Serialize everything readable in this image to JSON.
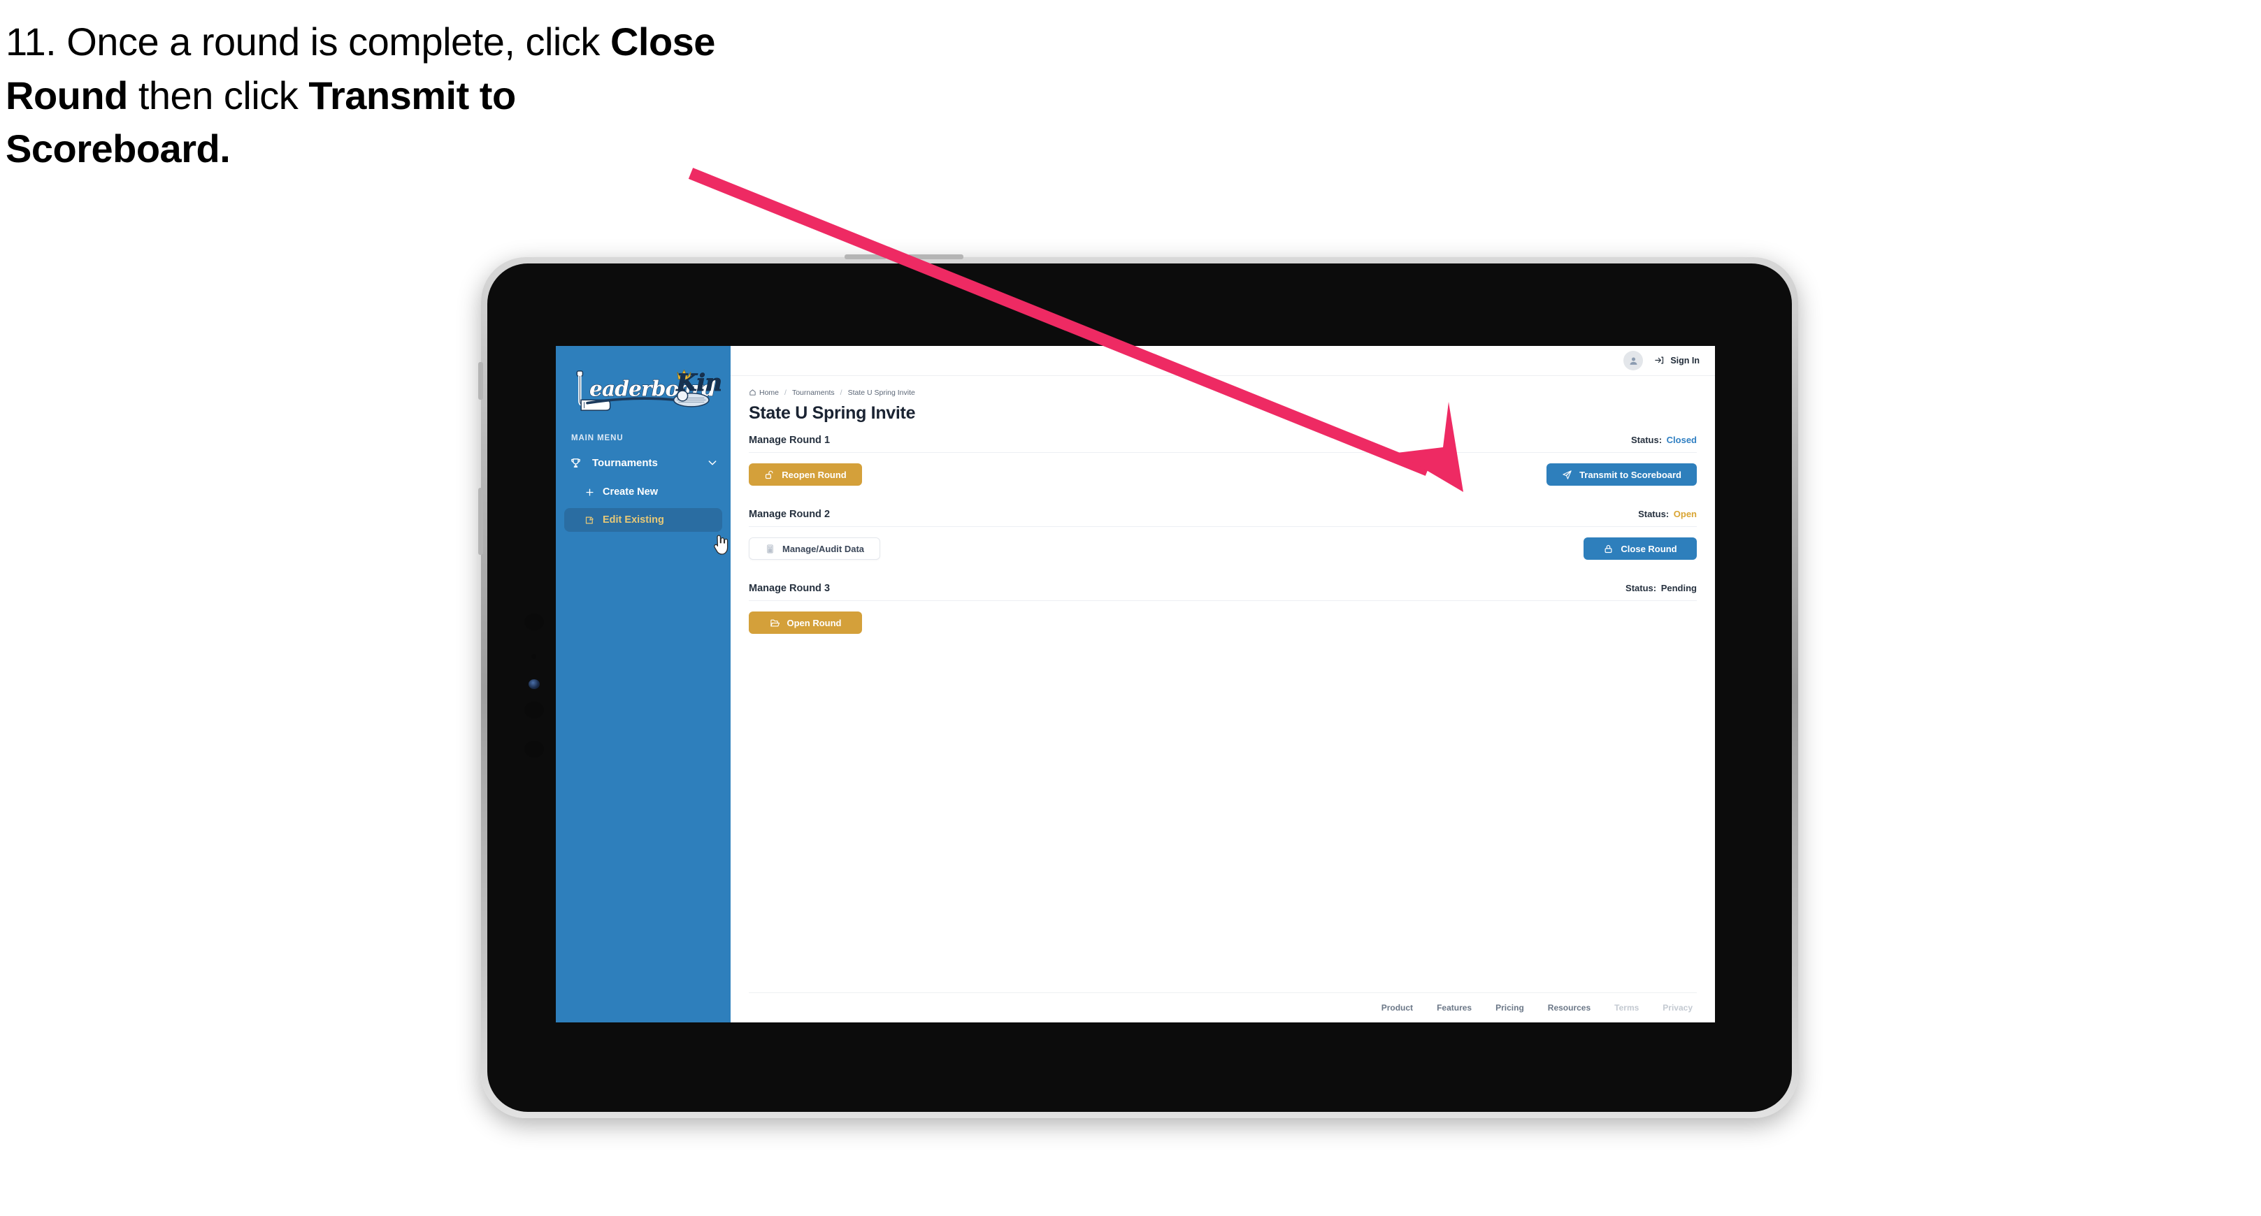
{
  "caption": {
    "part1": "11. Once a round is complete, click ",
    "bold1": "Close Round",
    "part2": " then click ",
    "bold2": "Transmit to Scoreboard."
  },
  "annotation": {
    "arrow_color": "#ee2a63",
    "points_to": "Transmit to Scoreboard"
  },
  "sidebar": {
    "logo": {
      "word1": "Leaderboard",
      "word2": "King",
      "icons": [
        "golf-putter-icon",
        "crown-icon",
        "golf-ball-icon"
      ]
    },
    "menu_label": "MAIN MENU",
    "nav": {
      "label": "Tournaments",
      "icon": "trophy-icon",
      "chevron": "chevron-down-icon"
    },
    "sub_items": [
      {
        "label": "Create New",
        "icon": "plus-icon",
        "active": false
      },
      {
        "label": "Edit Existing",
        "icon": "edit-square-icon",
        "active": true
      }
    ],
    "cursor": "pointing-hand-cursor",
    "colors": {
      "background": "#2E7FBC",
      "active_item_bg": "#2A6DA2",
      "active_item_text": "#E8C977"
    }
  },
  "topbar": {
    "avatar_icon": "user-avatar-icon",
    "signin_icon": "login-arrow-icon",
    "signin_label": "Sign In"
  },
  "breadcrumb": {
    "home_icon": "home-icon",
    "items": [
      "Home",
      "Tournaments",
      "State U Spring Invite"
    ],
    "separator": "/"
  },
  "page": {
    "title": "State U Spring Invite"
  },
  "rounds": [
    {
      "title": "Manage Round 1",
      "status_label": "Status:",
      "status_value": "Closed",
      "status_kind": "closed",
      "left_button": {
        "label": "Reopen Round",
        "icon": "unlock-icon",
        "style": "gold"
      },
      "right_button": {
        "label": "Transmit to Scoreboard",
        "icon": "paper-plane-icon",
        "style": "blue"
      }
    },
    {
      "title": "Manage Round 2",
      "status_label": "Status:",
      "status_value": "Open",
      "status_kind": "open",
      "left_button": {
        "label": "Manage/Audit Data",
        "icon": "calculator-icon",
        "style": "ghost"
      },
      "right_button": {
        "label": "Close Round",
        "icon": "lock-icon",
        "style": "blue"
      }
    },
    {
      "title": "Manage Round 3",
      "status_label": "Status:",
      "status_value": "Pending",
      "status_kind": "pending",
      "left_button": {
        "label": "Open Round",
        "icon": "open-folder-icon",
        "style": "gold"
      },
      "right_button": null
    }
  ],
  "footer": {
    "links": [
      {
        "label": "Product",
        "dim": false
      },
      {
        "label": "Features",
        "dim": false
      },
      {
        "label": "Pricing",
        "dim": false
      },
      {
        "label": "Resources",
        "dim": false
      },
      {
        "label": "Terms",
        "dim": true
      },
      {
        "label": "Privacy",
        "dim": true
      }
    ]
  },
  "colors": {
    "brand_blue": "#2E7FBC",
    "gold": "#D4A03A",
    "status_open": "#D9A534",
    "status_closed": "#2F7FC2",
    "text_dark": "#26313F",
    "annotation_pink": "#EE2A63"
  }
}
